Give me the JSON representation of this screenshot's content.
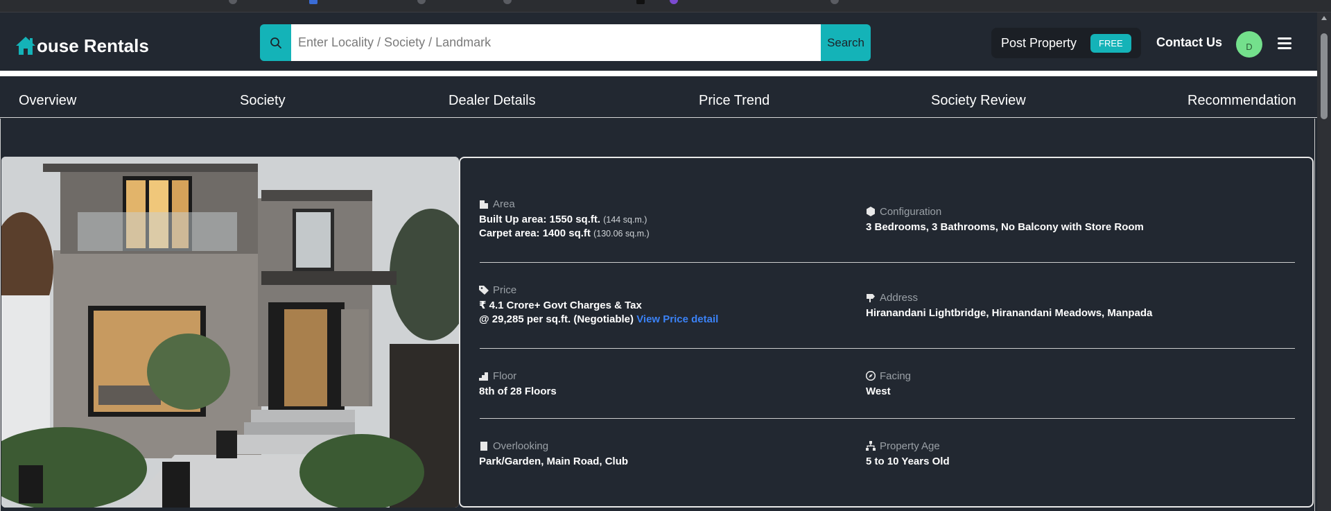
{
  "brand": {
    "letter_icon": "house-icon",
    "text": "ouse Rentals"
  },
  "search": {
    "placeholder": "Enter Locality / Society / Landmark",
    "button_label": "Search",
    "value": ""
  },
  "header": {
    "post_property_label": "Post Property",
    "free_badge": "FREE",
    "contact_label": "Contact Us",
    "avatar_initial": "D"
  },
  "tabs": [
    {
      "label": "Overview"
    },
    {
      "label": "Society"
    },
    {
      "label": "Dealer Details"
    },
    {
      "label": "Price Trend"
    },
    {
      "label": "Society Review"
    },
    {
      "label": "Recommendation"
    }
  ],
  "details": {
    "area": {
      "label": "Area",
      "icon": "building-icon",
      "built_up": "Built Up area: 1550 sq.ft.",
      "built_up_metric": "(144 sq.m.)",
      "carpet": "Carpet area: 1400 sq.ft",
      "carpet_metric": "(130.06 sq.m.)"
    },
    "configuration": {
      "label": "Configuration",
      "icon": "cube-icon",
      "value": "3 Bedrooms, 3 Bathrooms, No Balcony with Store Room"
    },
    "price": {
      "label": "Price",
      "icon": "tag-icon",
      "line1": "₹ 4.1 Crore+ Govt Charges & Tax",
      "line2": "@ 29,285 per sq.ft. (Negotiable)",
      "link": "View Price detail"
    },
    "address": {
      "label": "Address",
      "icon": "signpost-icon",
      "value": "Hiranandani Lightbridge, Hiranandani Meadows, Manpada"
    },
    "floor": {
      "label": "Floor",
      "icon": "stairs-icon",
      "value": "8th of 28 Floors"
    },
    "facing": {
      "label": "Facing",
      "icon": "compass-icon",
      "value": "West"
    },
    "overlooking": {
      "label": "Overlooking",
      "icon": "window-icon",
      "value": "Park/Garden, Main Road, Club"
    },
    "age": {
      "label": "Property Age",
      "icon": "sitemap-icon",
      "value": "5 to 10 Years Old"
    }
  },
  "colors": {
    "accent": "#14b3b8",
    "background": "#222831",
    "link": "#3b82f6",
    "avatar": "#74e08c"
  }
}
